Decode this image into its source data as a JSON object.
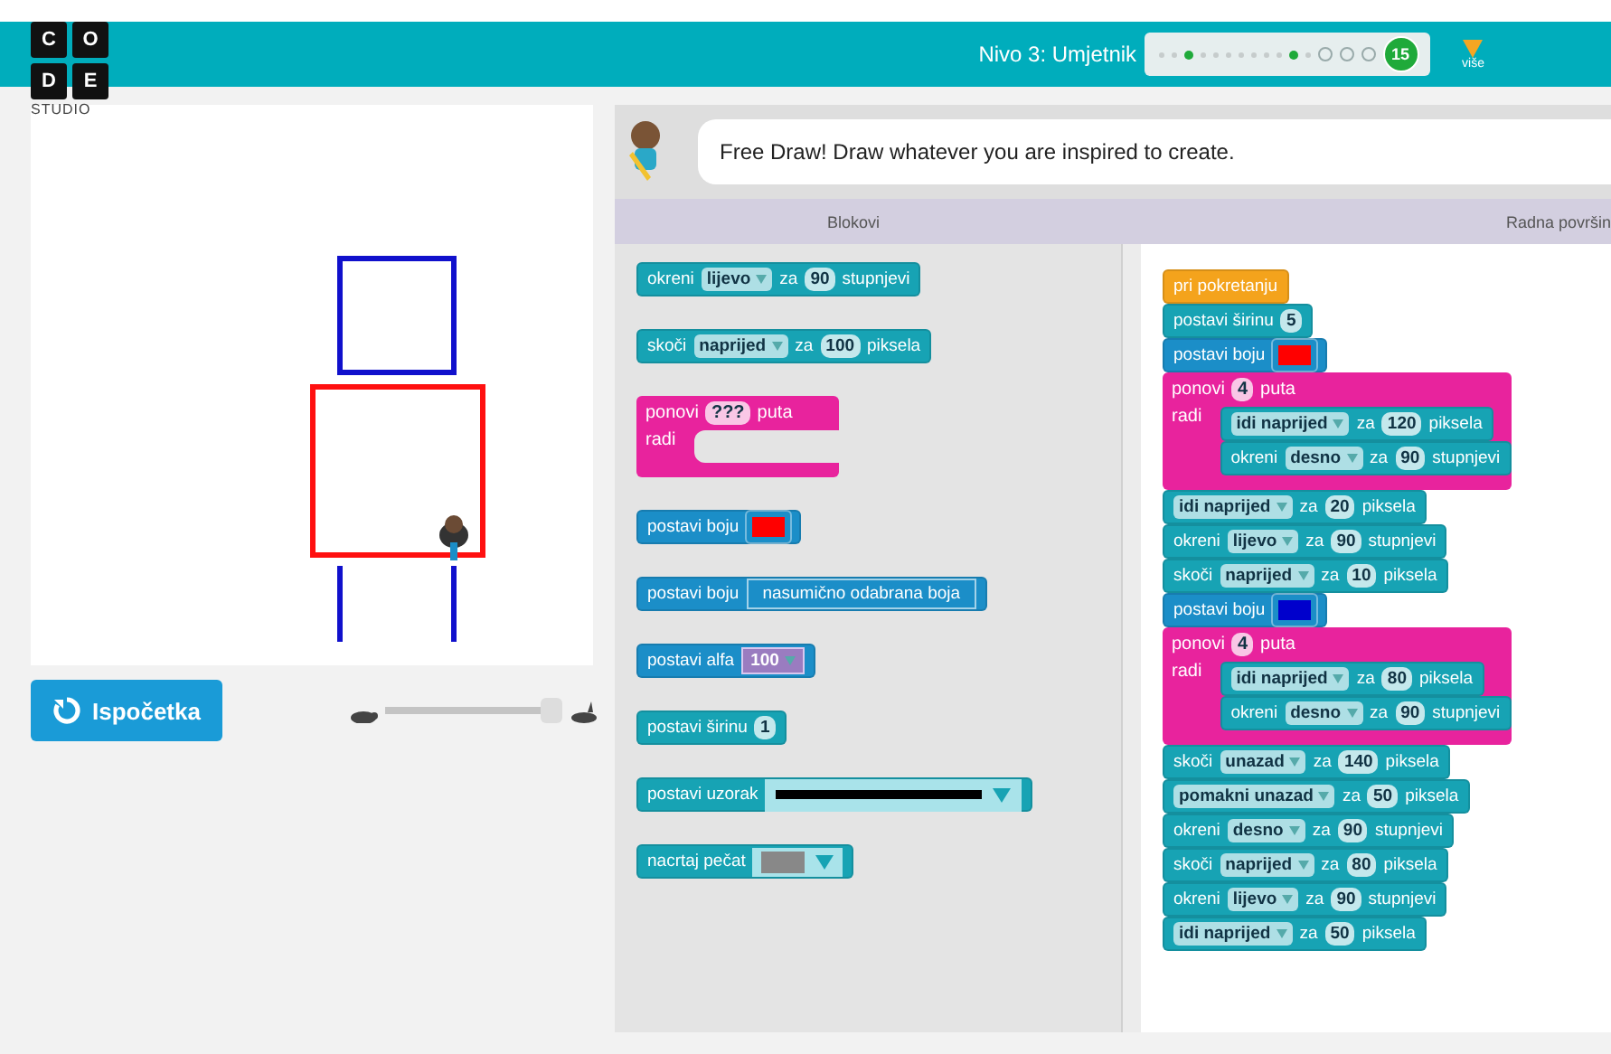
{
  "header": {
    "level_title": "Nivo 3: Umjetnik",
    "progress": [
      {
        "kind": "dot",
        "done": false
      },
      {
        "kind": "dot",
        "done": false
      },
      {
        "kind": "dot",
        "done": true
      },
      {
        "kind": "dot",
        "done": false
      },
      {
        "kind": "dot",
        "done": false
      },
      {
        "kind": "dot",
        "done": false
      },
      {
        "kind": "dot",
        "done": false
      },
      {
        "kind": "dot",
        "done": false
      },
      {
        "kind": "dot",
        "done": false
      },
      {
        "kind": "dot",
        "done": false
      },
      {
        "kind": "dot",
        "done": true
      },
      {
        "kind": "dot",
        "done": false
      },
      {
        "kind": "ring",
        "done": false
      },
      {
        "kind": "ring",
        "done": false
      },
      {
        "kind": "ring",
        "done": false
      },
      {
        "kind": "current",
        "label": "15"
      }
    ],
    "more_label": "više",
    "logo_letters": [
      "C",
      "O",
      "D",
      "E"
    ],
    "logo_caption": "STUDIO"
  },
  "stage": {
    "reset_button": "Ispočetka",
    "speed": {
      "level": 1.0
    }
  },
  "instructions": {
    "text": "Free Draw! Draw whatever you are inspired to create."
  },
  "tabs": [
    {
      "label": "Blokovi"
    },
    {
      "label": "Radna površin"
    }
  ],
  "palette": [
    {
      "kind": "motion",
      "parts": [
        {
          "kind": "label",
          "text": "okreni"
        },
        {
          "kind": "menu",
          "text": "lijevo"
        },
        {
          "kind": "label",
          "text": "za"
        },
        {
          "kind": "number",
          "text": "90"
        },
        {
          "kind": "label",
          "text": "stupnjevi"
        }
      ]
    },
    {
      "kind": "motion",
      "parts": [
        {
          "kind": "label",
          "text": "skoči"
        },
        {
          "kind": "menu",
          "text": "naprijed"
        },
        {
          "kind": "label",
          "text": "za"
        },
        {
          "kind": "number",
          "text": "100"
        },
        {
          "kind": "label",
          "text": "piksela"
        }
      ]
    },
    {
      "kind": "loop",
      "parts": [
        {
          "kind": "label",
          "text": "ponovi"
        },
        {
          "kind": "number",
          "text": "???"
        },
        {
          "kind": "label",
          "text": "puta"
        }
      ],
      "do_label": "radi"
    },
    {
      "kind": "pen",
      "parts": [
        {
          "kind": "label",
          "text": "postavi boju"
        },
        {
          "kind": "swatch",
          "color": "#ff0000"
        }
      ]
    },
    {
      "kind": "pen",
      "parts": [
        {
          "kind": "label",
          "text": "postavi boju"
        },
        {
          "kind": "wide",
          "text": "nasumično odabrana boja"
        }
      ]
    },
    {
      "kind": "pen",
      "parts": [
        {
          "kind": "label",
          "text": "postavi alfa"
        },
        {
          "kind": "alpha",
          "text": "100"
        }
      ]
    },
    {
      "kind": "motion",
      "parts": [
        {
          "kind": "label",
          "text": "postavi širinu"
        },
        {
          "kind": "number",
          "text": "1"
        }
      ]
    },
    {
      "kind": "motion",
      "parts": [
        {
          "kind": "label",
          "text": "postavi uzorak"
        },
        {
          "kind": "pattern"
        }
      ]
    },
    {
      "kind": "motion",
      "parts": [
        {
          "kind": "label",
          "text": "nacrtaj pečat"
        },
        {
          "kind": "stamp"
        }
      ]
    }
  ],
  "workspace": [
    {
      "kind": "event",
      "parts": [
        {
          "kind": "label",
          "text": "pri pokretanju"
        }
      ]
    },
    {
      "kind": "motion",
      "parts": [
        {
          "kind": "label",
          "text": "postavi širinu"
        },
        {
          "kind": "number",
          "text": "5"
        }
      ]
    },
    {
      "kind": "pen",
      "parts": [
        {
          "kind": "label",
          "text": "postavi boju"
        },
        {
          "kind": "swatch",
          "color": "#ff0000"
        }
      ]
    },
    {
      "kind": "loop",
      "parts": [
        {
          "kind": "label",
          "text": "ponovi"
        },
        {
          "kind": "number",
          "text": "4"
        },
        {
          "kind": "label",
          "text": "puta"
        }
      ],
      "do_label": "radi",
      "children": [
        {
          "kind": "motion",
          "parts": [
            {
              "kind": "menu",
              "text": "idi naprijed"
            },
            {
              "kind": "label",
              "text": "za"
            },
            {
              "kind": "number",
              "text": "120"
            },
            {
              "kind": "label",
              "text": "piksela"
            }
          ]
        },
        {
          "kind": "motion",
          "parts": [
            {
              "kind": "label",
              "text": "okreni"
            },
            {
              "kind": "menu",
              "text": "desno"
            },
            {
              "kind": "label",
              "text": "za"
            },
            {
              "kind": "number",
              "text": "90"
            },
            {
              "kind": "label",
              "text": "stupnjevi"
            }
          ]
        }
      ]
    },
    {
      "kind": "motion",
      "parts": [
        {
          "kind": "menu",
          "text": "idi naprijed"
        },
        {
          "kind": "label",
          "text": "za"
        },
        {
          "kind": "number",
          "text": "20"
        },
        {
          "kind": "label",
          "text": "piksela"
        }
      ]
    },
    {
      "kind": "motion",
      "parts": [
        {
          "kind": "label",
          "text": "okreni"
        },
        {
          "kind": "menu",
          "text": "lijevo"
        },
        {
          "kind": "label",
          "text": "za"
        },
        {
          "kind": "number",
          "text": "90"
        },
        {
          "kind": "label",
          "text": "stupnjevi"
        }
      ]
    },
    {
      "kind": "motion",
      "parts": [
        {
          "kind": "label",
          "text": "skoči"
        },
        {
          "kind": "menu",
          "text": "naprijed"
        },
        {
          "kind": "label",
          "text": "za"
        },
        {
          "kind": "number",
          "text": "10"
        },
        {
          "kind": "label",
          "text": "piksela"
        }
      ]
    },
    {
      "kind": "pen",
      "parts": [
        {
          "kind": "label",
          "text": "postavi boju"
        },
        {
          "kind": "swatch",
          "color": "#0000cc"
        }
      ]
    },
    {
      "kind": "loop",
      "parts": [
        {
          "kind": "label",
          "text": "ponovi"
        },
        {
          "kind": "number",
          "text": "4"
        },
        {
          "kind": "label",
          "text": "puta"
        }
      ],
      "do_label": "radi",
      "children": [
        {
          "kind": "motion",
          "parts": [
            {
              "kind": "menu",
              "text": "idi naprijed"
            },
            {
              "kind": "label",
              "text": "za"
            },
            {
              "kind": "number",
              "text": "80"
            },
            {
              "kind": "label",
              "text": "piksela"
            }
          ]
        },
        {
          "kind": "motion",
          "parts": [
            {
              "kind": "label",
              "text": "okreni"
            },
            {
              "kind": "menu",
              "text": "desno"
            },
            {
              "kind": "label",
              "text": "za"
            },
            {
              "kind": "number",
              "text": "90"
            },
            {
              "kind": "label",
              "text": "stupnjevi"
            }
          ]
        }
      ]
    },
    {
      "kind": "motion",
      "parts": [
        {
          "kind": "label",
          "text": "skoči"
        },
        {
          "kind": "menu",
          "text": "unazad"
        },
        {
          "kind": "label",
          "text": "za"
        },
        {
          "kind": "number",
          "text": "140"
        },
        {
          "kind": "label",
          "text": "piksela"
        }
      ]
    },
    {
      "kind": "motion",
      "parts": [
        {
          "kind": "menu",
          "text": "pomakni unazad"
        },
        {
          "kind": "label",
          "text": "za"
        },
        {
          "kind": "number",
          "text": "50"
        },
        {
          "kind": "label",
          "text": "piksela"
        }
      ]
    },
    {
      "kind": "motion",
      "parts": [
        {
          "kind": "label",
          "text": "okreni"
        },
        {
          "kind": "menu",
          "text": "desno"
        },
        {
          "kind": "label",
          "text": "za"
        },
        {
          "kind": "number",
          "text": "90"
        },
        {
          "kind": "label",
          "text": "stupnjevi"
        }
      ]
    },
    {
      "kind": "motion",
      "parts": [
        {
          "kind": "label",
          "text": "skoči"
        },
        {
          "kind": "menu",
          "text": "naprijed"
        },
        {
          "kind": "label",
          "text": "za"
        },
        {
          "kind": "number",
          "text": "80"
        },
        {
          "kind": "label",
          "text": "piksela"
        }
      ]
    },
    {
      "kind": "motion",
      "parts": [
        {
          "kind": "label",
          "text": "okreni"
        },
        {
          "kind": "menu",
          "text": "lijevo"
        },
        {
          "kind": "label",
          "text": "za"
        },
        {
          "kind": "number",
          "text": "90"
        },
        {
          "kind": "label",
          "text": "stupnjevi"
        }
      ]
    },
    {
      "kind": "motion",
      "parts": [
        {
          "kind": "menu",
          "text": "idi naprijed"
        },
        {
          "kind": "label",
          "text": "za"
        },
        {
          "kind": "number",
          "text": "50"
        },
        {
          "kind": "label",
          "text": "piksela"
        }
      ]
    }
  ]
}
